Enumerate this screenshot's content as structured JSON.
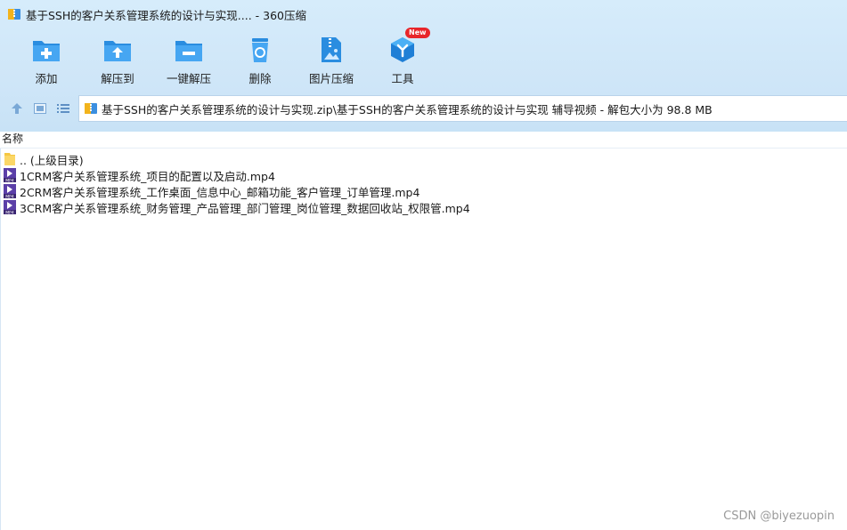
{
  "window": {
    "title": "基于SSH的客户关系管理系统的设计与实现.... - 360压缩",
    "app_icon": "zip-archive-icon"
  },
  "toolbar": {
    "items": [
      {
        "label": "添加",
        "icon": "add-folder-icon"
      },
      {
        "label": "解压到",
        "icon": "extract-to-folder-icon"
      },
      {
        "label": "一键解压",
        "icon": "one-click-extract-icon"
      },
      {
        "label": "删除",
        "icon": "recycle-bin-icon"
      },
      {
        "label": "图片压缩",
        "icon": "image-compress-icon"
      },
      {
        "label": "工具",
        "icon": "tools-cube-icon",
        "badge": "New"
      }
    ]
  },
  "nav": {
    "up_icon": "up-arrow-icon",
    "view_icon": "preview-icon",
    "list_icon": "list-view-icon",
    "path": "基于SSH的客户关系管理系统的设计与实现.zip\\基于SSH的客户关系管理系统的设计与实现 辅导视频 - 解包大小为 98.8 MB"
  },
  "columns": {
    "name": "名称"
  },
  "files": [
    {
      "name": ".. (上级目录)",
      "icon": "folder-icon"
    },
    {
      "name": "1CRM客户关系管理系统_项目的配置以及启动.mp4",
      "icon": "mp4-file-icon"
    },
    {
      "name": "2CRM客户关系管理系统_工作桌面_信息中心_邮箱功能_客户管理_订单管理.mp4",
      "icon": "mp4-file-icon"
    },
    {
      "name": "3CRM客户关系管理系统_财务管理_产品管理_部门管理_岗位管理_数据回收站_权限管.mp4",
      "icon": "mp4-file-icon"
    }
  ],
  "watermark": "CSDN @biyezuopin",
  "colors": {
    "toolbar_bg": "#cfe6f8",
    "icon_blue": "#2a8de0",
    "badge_red": "#e8262b"
  }
}
